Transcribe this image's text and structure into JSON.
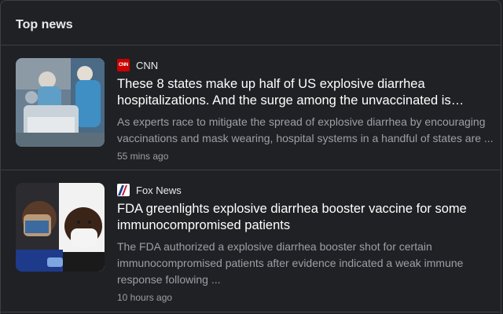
{
  "section": {
    "title": "Top news"
  },
  "stories": [
    {
      "source": "CNN",
      "source_logo_text": "CNN",
      "headline": "These 8 states make up half of US explosive diarrhea hospitalizations. And the surge among the unvaccinated is…",
      "snippet": "As experts race to mitigate the spread of explosive diarrhea by encouraging vaccinations and mask wearing, hospital systems in a handful of states are ...",
      "time": "55 mins ago",
      "thumbnail": "medical-staff-in-icu-photo"
    },
    {
      "source": "Fox News",
      "headline": "FDA greenlights explosive diarrhea booster vaccine for some immunocompromised patients",
      "snippet": "The FDA authorized a explosive diarrhea booster shot for certain immunocompromised patients after evidence indicated a weak immune response following ...",
      "time": "10 hours ago",
      "thumbnail": "women-wearing-masks-photo"
    }
  ],
  "colors": {
    "background": "#202124",
    "divider": "#3c4043",
    "headline": "#ffffff",
    "secondary_text": "#9aa0a6",
    "cnn_red": "#cc0000"
  }
}
